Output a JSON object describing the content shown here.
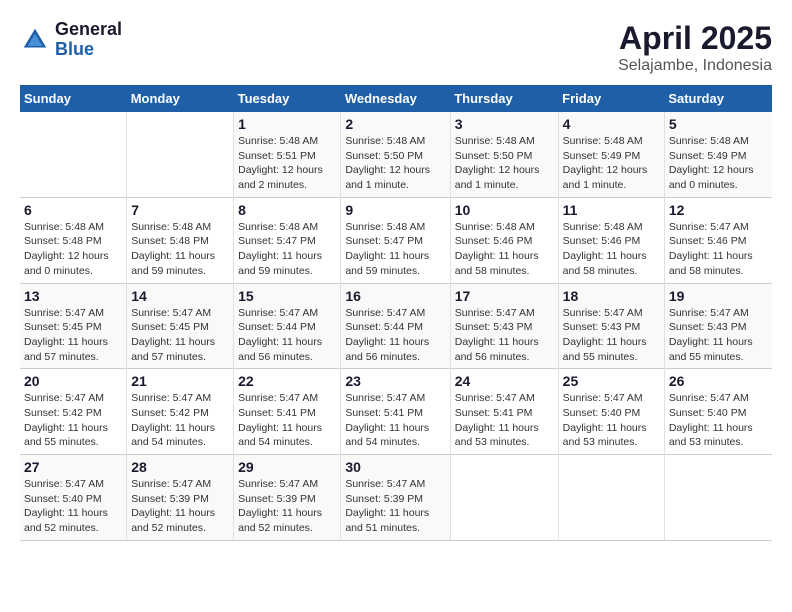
{
  "logo": {
    "general": "General",
    "blue": "Blue"
  },
  "title": "April 2025",
  "subtitle": "Selajambe, Indonesia",
  "weekdays": [
    "Sunday",
    "Monday",
    "Tuesday",
    "Wednesday",
    "Thursday",
    "Friday",
    "Saturday"
  ],
  "weeks": [
    [
      {
        "day": "",
        "detail": ""
      },
      {
        "day": "",
        "detail": ""
      },
      {
        "day": "1",
        "detail": "Sunrise: 5:48 AM\nSunset: 5:51 PM\nDaylight: 12 hours\nand 2 minutes."
      },
      {
        "day": "2",
        "detail": "Sunrise: 5:48 AM\nSunset: 5:50 PM\nDaylight: 12 hours\nand 1 minute."
      },
      {
        "day": "3",
        "detail": "Sunrise: 5:48 AM\nSunset: 5:50 PM\nDaylight: 12 hours\nand 1 minute."
      },
      {
        "day": "4",
        "detail": "Sunrise: 5:48 AM\nSunset: 5:49 PM\nDaylight: 12 hours\nand 1 minute."
      },
      {
        "day": "5",
        "detail": "Sunrise: 5:48 AM\nSunset: 5:49 PM\nDaylight: 12 hours\nand 0 minutes."
      }
    ],
    [
      {
        "day": "6",
        "detail": "Sunrise: 5:48 AM\nSunset: 5:48 PM\nDaylight: 12 hours\nand 0 minutes."
      },
      {
        "day": "7",
        "detail": "Sunrise: 5:48 AM\nSunset: 5:48 PM\nDaylight: 11 hours\nand 59 minutes."
      },
      {
        "day": "8",
        "detail": "Sunrise: 5:48 AM\nSunset: 5:47 PM\nDaylight: 11 hours\nand 59 minutes."
      },
      {
        "day": "9",
        "detail": "Sunrise: 5:48 AM\nSunset: 5:47 PM\nDaylight: 11 hours\nand 59 minutes."
      },
      {
        "day": "10",
        "detail": "Sunrise: 5:48 AM\nSunset: 5:46 PM\nDaylight: 11 hours\nand 58 minutes."
      },
      {
        "day": "11",
        "detail": "Sunrise: 5:48 AM\nSunset: 5:46 PM\nDaylight: 11 hours\nand 58 minutes."
      },
      {
        "day": "12",
        "detail": "Sunrise: 5:47 AM\nSunset: 5:46 PM\nDaylight: 11 hours\nand 58 minutes."
      }
    ],
    [
      {
        "day": "13",
        "detail": "Sunrise: 5:47 AM\nSunset: 5:45 PM\nDaylight: 11 hours\nand 57 minutes."
      },
      {
        "day": "14",
        "detail": "Sunrise: 5:47 AM\nSunset: 5:45 PM\nDaylight: 11 hours\nand 57 minutes."
      },
      {
        "day": "15",
        "detail": "Sunrise: 5:47 AM\nSunset: 5:44 PM\nDaylight: 11 hours\nand 56 minutes."
      },
      {
        "day": "16",
        "detail": "Sunrise: 5:47 AM\nSunset: 5:44 PM\nDaylight: 11 hours\nand 56 minutes."
      },
      {
        "day": "17",
        "detail": "Sunrise: 5:47 AM\nSunset: 5:43 PM\nDaylight: 11 hours\nand 56 minutes."
      },
      {
        "day": "18",
        "detail": "Sunrise: 5:47 AM\nSunset: 5:43 PM\nDaylight: 11 hours\nand 55 minutes."
      },
      {
        "day": "19",
        "detail": "Sunrise: 5:47 AM\nSunset: 5:43 PM\nDaylight: 11 hours\nand 55 minutes."
      }
    ],
    [
      {
        "day": "20",
        "detail": "Sunrise: 5:47 AM\nSunset: 5:42 PM\nDaylight: 11 hours\nand 55 minutes."
      },
      {
        "day": "21",
        "detail": "Sunrise: 5:47 AM\nSunset: 5:42 PM\nDaylight: 11 hours\nand 54 minutes."
      },
      {
        "day": "22",
        "detail": "Sunrise: 5:47 AM\nSunset: 5:41 PM\nDaylight: 11 hours\nand 54 minutes."
      },
      {
        "day": "23",
        "detail": "Sunrise: 5:47 AM\nSunset: 5:41 PM\nDaylight: 11 hours\nand 54 minutes."
      },
      {
        "day": "24",
        "detail": "Sunrise: 5:47 AM\nSunset: 5:41 PM\nDaylight: 11 hours\nand 53 minutes."
      },
      {
        "day": "25",
        "detail": "Sunrise: 5:47 AM\nSunset: 5:40 PM\nDaylight: 11 hours\nand 53 minutes."
      },
      {
        "day": "26",
        "detail": "Sunrise: 5:47 AM\nSunset: 5:40 PM\nDaylight: 11 hours\nand 53 minutes."
      }
    ],
    [
      {
        "day": "27",
        "detail": "Sunrise: 5:47 AM\nSunset: 5:40 PM\nDaylight: 11 hours\nand 52 minutes."
      },
      {
        "day": "28",
        "detail": "Sunrise: 5:47 AM\nSunset: 5:39 PM\nDaylight: 11 hours\nand 52 minutes."
      },
      {
        "day": "29",
        "detail": "Sunrise: 5:47 AM\nSunset: 5:39 PM\nDaylight: 11 hours\nand 52 minutes."
      },
      {
        "day": "30",
        "detail": "Sunrise: 5:47 AM\nSunset: 5:39 PM\nDaylight: 11 hours\nand 51 minutes."
      },
      {
        "day": "",
        "detail": ""
      },
      {
        "day": "",
        "detail": ""
      },
      {
        "day": "",
        "detail": ""
      }
    ]
  ]
}
